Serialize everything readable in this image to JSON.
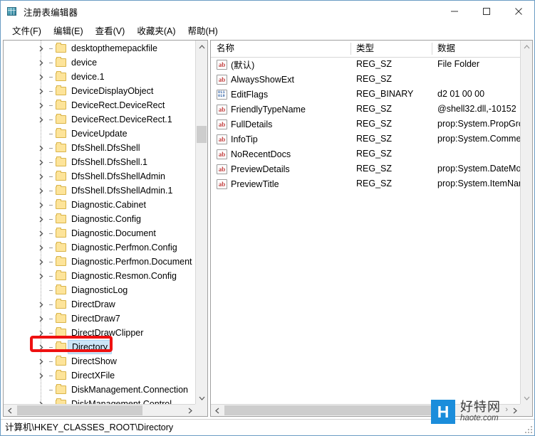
{
  "window": {
    "title": "注册表编辑器",
    "icon": "registry-editor-icon",
    "accent_color": "#6a9cc4",
    "controls": [
      {
        "name": "minimize",
        "glyph": "—"
      },
      {
        "name": "maximize",
        "glyph": "□"
      },
      {
        "name": "close",
        "glyph": "✕"
      }
    ]
  },
  "menubar": {
    "items": [
      {
        "label": "文件(F)"
      },
      {
        "label": "编辑(E)"
      },
      {
        "label": "查看(V)"
      },
      {
        "label": "收藏夹(A)"
      },
      {
        "label": "帮助(H)"
      }
    ]
  },
  "tree": {
    "selected": "Directory",
    "items": [
      {
        "label": "desktopthemepackfile",
        "expandable": true
      },
      {
        "label": "device",
        "expandable": true
      },
      {
        "label": "device.1",
        "expandable": true
      },
      {
        "label": "DeviceDisplayObject",
        "expandable": true
      },
      {
        "label": "DeviceRect.DeviceRect",
        "expandable": true
      },
      {
        "label": "DeviceRect.DeviceRect.1",
        "expandable": true
      },
      {
        "label": "DeviceUpdate",
        "expandable": false
      },
      {
        "label": "DfsShell.DfsShell",
        "expandable": true
      },
      {
        "label": "DfsShell.DfsShell.1",
        "expandable": true
      },
      {
        "label": "DfsShell.DfsShellAdmin",
        "expandable": true
      },
      {
        "label": "DfsShell.DfsShellAdmin.1",
        "expandable": true
      },
      {
        "label": "Diagnostic.Cabinet",
        "expandable": true
      },
      {
        "label": "Diagnostic.Config",
        "expandable": true
      },
      {
        "label": "Diagnostic.Document",
        "expandable": true
      },
      {
        "label": "Diagnostic.Perfmon.Config",
        "expandable": true
      },
      {
        "label": "Diagnostic.Perfmon.Document",
        "expandable": true
      },
      {
        "label": "Diagnostic.Resmon.Config",
        "expandable": true
      },
      {
        "label": "DiagnosticLog",
        "expandable": false
      },
      {
        "label": "DirectDraw",
        "expandable": true
      },
      {
        "label": "DirectDraw7",
        "expandable": true
      },
      {
        "label": "DirectDrawClipper",
        "expandable": true
      },
      {
        "label": "Directory",
        "expandable": true,
        "selected": true
      },
      {
        "label": "DirectShow",
        "expandable": true
      },
      {
        "label": "DirectXFile",
        "expandable": true
      },
      {
        "label": "DiskManagement.Connection",
        "expandable": false
      },
      {
        "label": "DiskManagement.Control",
        "expandable": true
      }
    ]
  },
  "values": {
    "columns": [
      "名称",
      "类型",
      "数据"
    ],
    "rows": [
      {
        "name": "(默认)",
        "type": "REG_SZ",
        "data": "File Folder",
        "icon": "string-value-icon"
      },
      {
        "name": "AlwaysShowExt",
        "type": "REG_SZ",
        "data": "",
        "icon": "string-value-icon"
      },
      {
        "name": "EditFlags",
        "type": "REG_BINARY",
        "data": "d2 01 00 00",
        "icon": "binary-value-icon"
      },
      {
        "name": "FriendlyTypeName",
        "type": "REG_SZ",
        "data": "@shell32.dll,-10152",
        "icon": "string-value-icon"
      },
      {
        "name": "FullDetails",
        "type": "REG_SZ",
        "data": "prop:System.PropGroup",
        "icon": "string-value-icon"
      },
      {
        "name": "InfoTip",
        "type": "REG_SZ",
        "data": "prop:System.Comment",
        "icon": "string-value-icon"
      },
      {
        "name": "NoRecentDocs",
        "type": "REG_SZ",
        "data": "",
        "icon": "string-value-icon"
      },
      {
        "name": "PreviewDetails",
        "type": "REG_SZ",
        "data": "prop:System.DateModif",
        "icon": "string-value-icon"
      },
      {
        "name": "PreviewTitle",
        "type": "REG_SZ",
        "data": "prop:System.ItemName",
        "icon": "string-value-icon"
      }
    ]
  },
  "statusbar": {
    "path": "计算机\\HKEY_CLASSES_ROOT\\Directory"
  },
  "annotation": {
    "target": "Directory",
    "color": "#ee1111"
  },
  "watermark": {
    "logo_letter": "H",
    "chinese": "好特网",
    "domain": "haote.com",
    "color": "#1b8ddb"
  }
}
